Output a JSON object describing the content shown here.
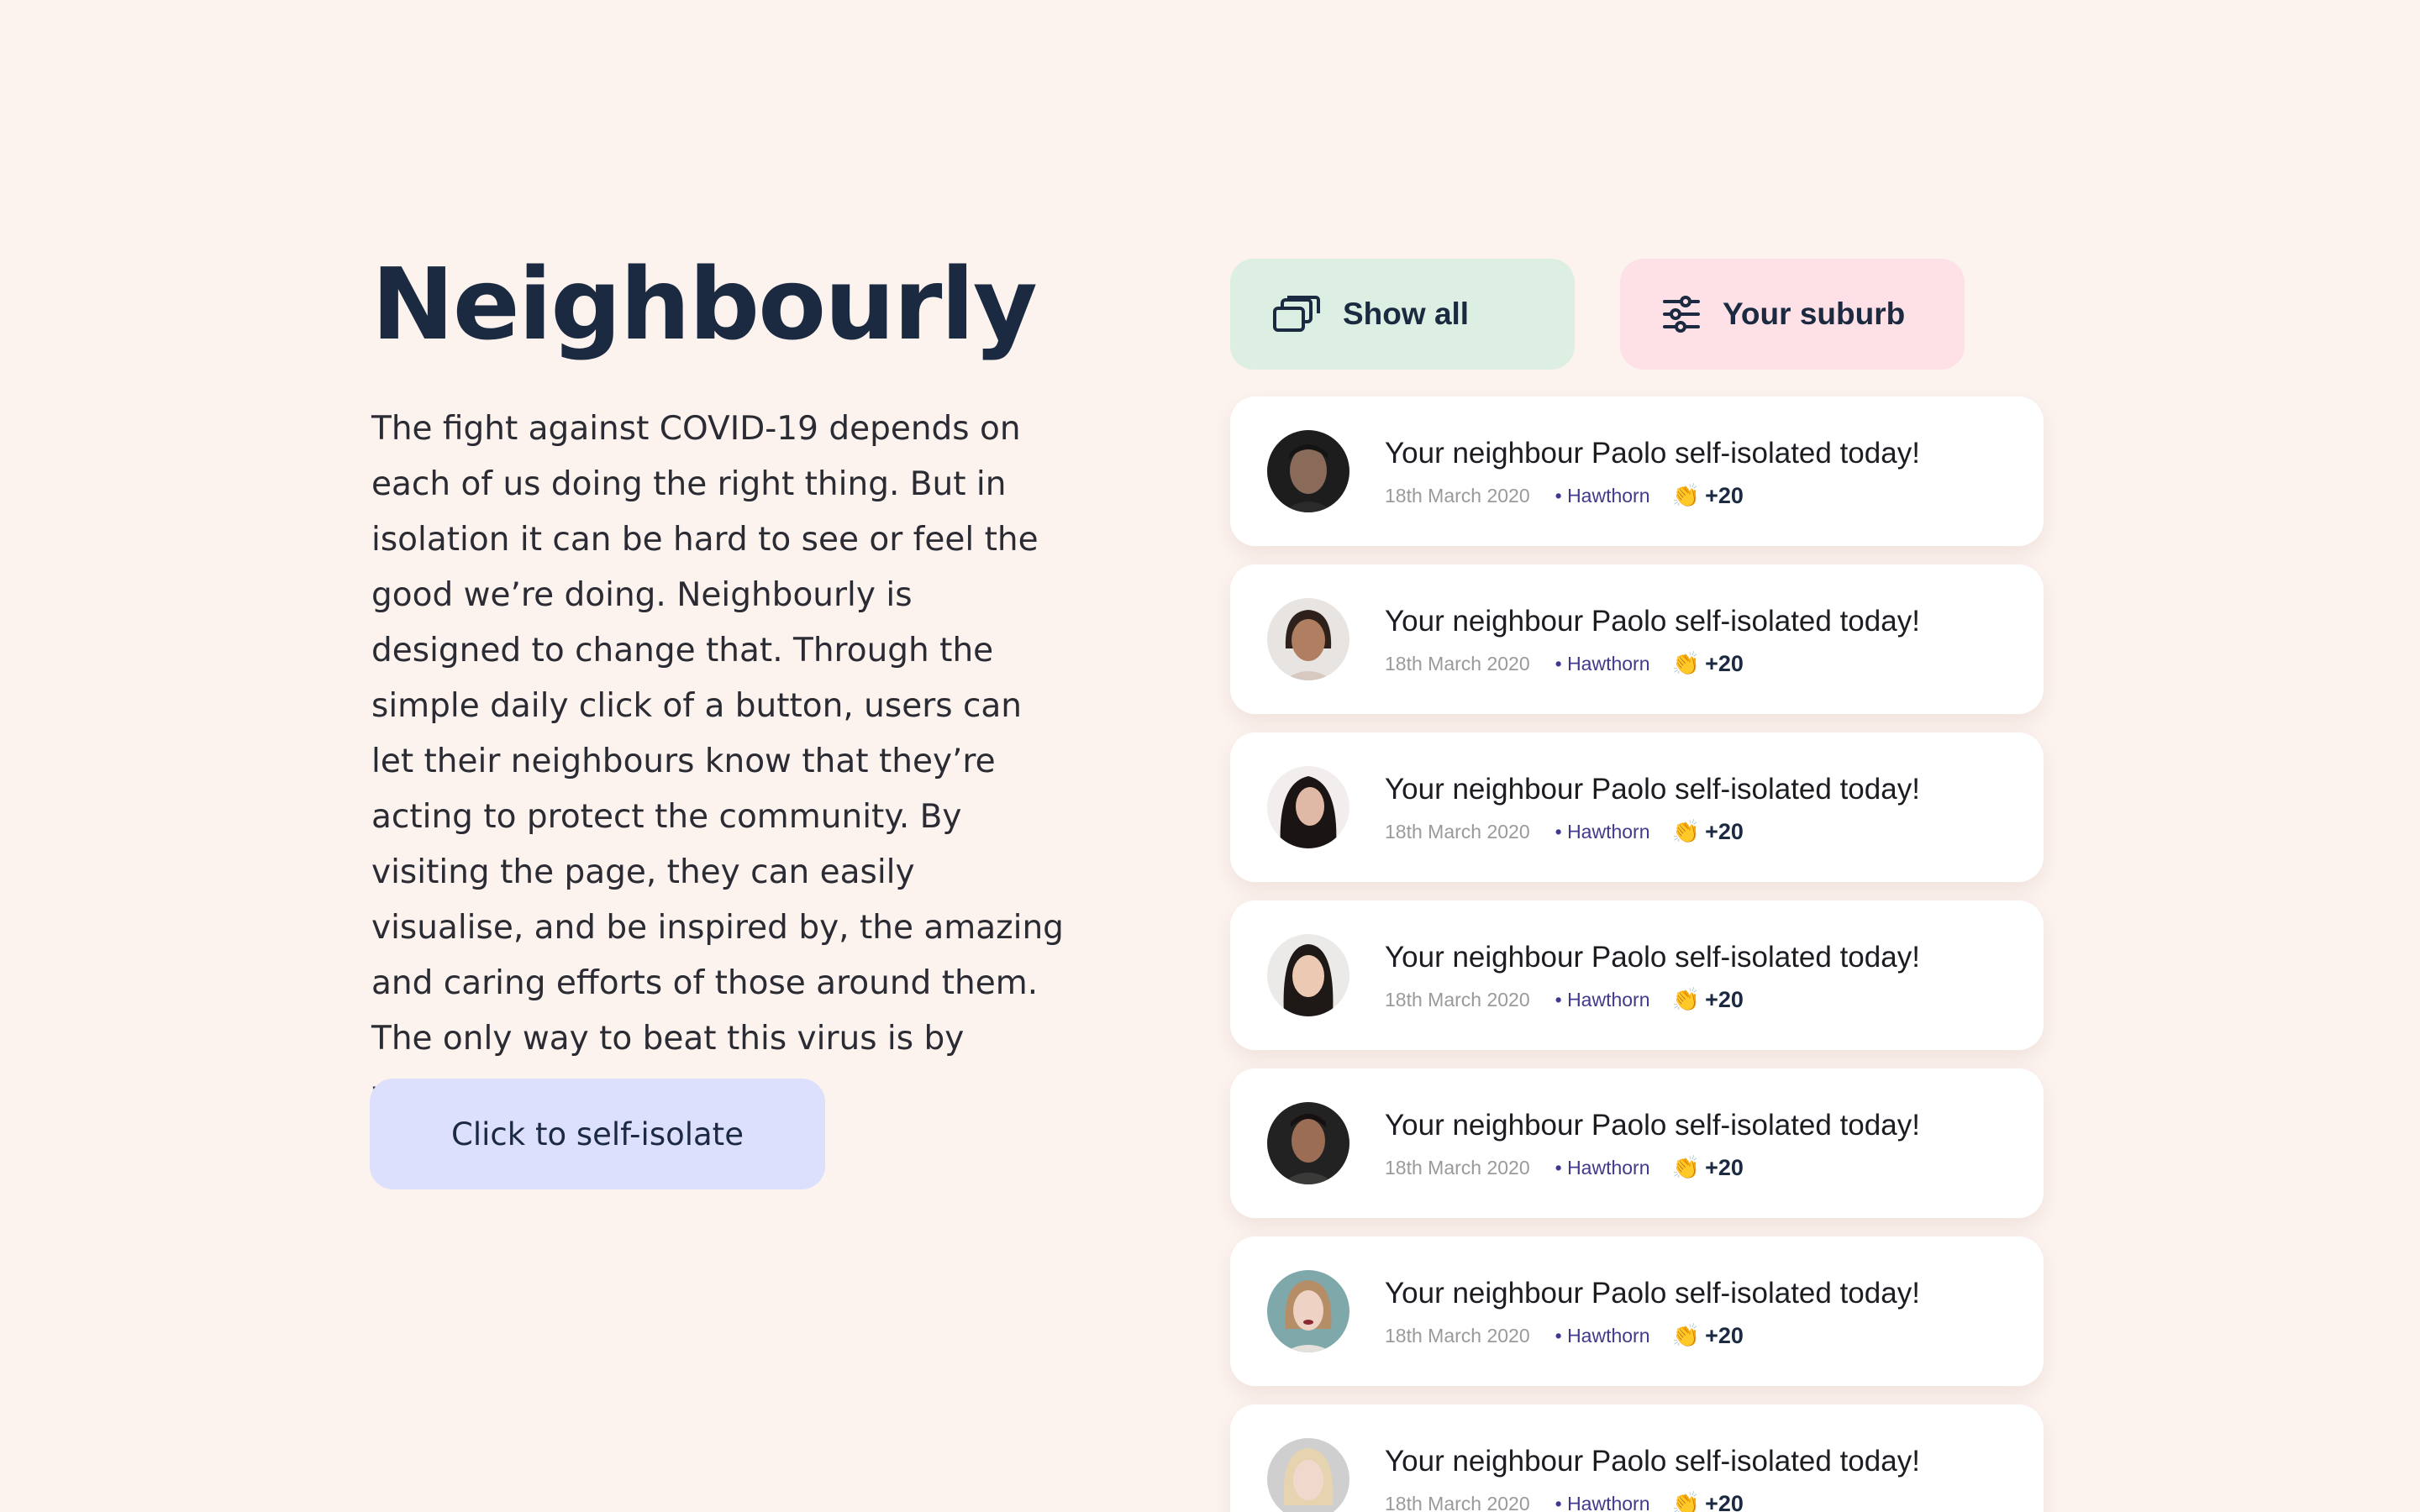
{
  "hero": {
    "title": "Neighbourly",
    "description": "The fight against COVID-19 depends on each of us doing the right thing. But in isolation it can be hard to see or feel the good we’re doing. Neighbourly is designed to change that. Through the simple daily click of a button, users can let their neighbours know that they’re acting to protect the community. By visiting the page, they can easily visualise, and be inspired by, the amazing and caring efforts of those around them. The only way to beat this virus is by working together.",
    "cta_label": "Click to self-isolate"
  },
  "filters": {
    "show_all_label": "Show all",
    "your_suburb_label": "Your suburb"
  },
  "feed": [
    {
      "message": "Your neighbour Paolo self-isolated today!",
      "date": "18th March 2020",
      "suburb": "• Hawthorn",
      "clap": "👏",
      "count": "+20"
    },
    {
      "message": "Your neighbour Paolo self-isolated today!",
      "date": "18th March 2020",
      "suburb": "• Hawthorn",
      "clap": "👏",
      "count": "+20"
    },
    {
      "message": "Your neighbour Paolo self-isolated today!",
      "date": "18th March 2020",
      "suburb": "• Hawthorn",
      "clap": "👏",
      "count": "+20"
    },
    {
      "message": "Your neighbour Paolo self-isolated today!",
      "date": "18th March 2020",
      "suburb": "• Hawthorn",
      "clap": "👏",
      "count": "+20"
    },
    {
      "message": "Your neighbour Paolo self-isolated today!",
      "date": "18th March 2020",
      "suburb": "• Hawthorn",
      "clap": "👏",
      "count": "+20"
    },
    {
      "message": "Your neighbour Paolo self-isolated today!",
      "date": "18th March 2020",
      "suburb": "• Hawthorn",
      "clap": "👏",
      "count": "+20"
    },
    {
      "message": "Your neighbour Paolo self-isolated today!",
      "date": "18th March 2020",
      "suburb": "• Hawthorn",
      "clap": "👏",
      "count": "+20"
    }
  ],
  "colors": {
    "background": "#fcf3ef",
    "title": "#1b2a40",
    "cta_bg": "#dde0fd",
    "show_all_bg": "#dcefe2",
    "your_suburb_bg": "#fde1e6",
    "suburb_text": "#3f3a8c"
  },
  "icons": {
    "show_all": "stacked-windows-icon",
    "your_suburb": "sliders-icon",
    "clap": "clapping-hands-icon"
  }
}
